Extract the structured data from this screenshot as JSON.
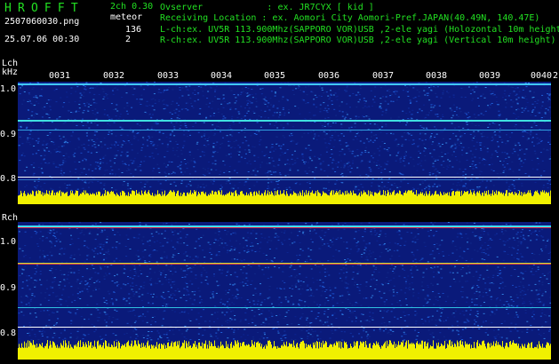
{
  "header": {
    "brand": "HROFFT",
    "filename": "2507060030.png",
    "datetime": "25.07.06 00:30",
    "mode": "2ch 0.30",
    "meteor_label": "meteor",
    "meteor_count": "136",
    "channel_count": "2"
  },
  "info": {
    "observer": "Ovserver            : ex. JR7CYX [ kid ]",
    "location": "Receiving Location : ex. Aomori City Aomori-Pref.JAPAN(40.49N, 140.47E)",
    "lch": "L-ch:ex. UV5R 113.900Mhz(SAPPORO VOR)USB ,2-ele yagi (Holozontal 10m height",
    "rch": "R-ch:ex. UV5R 113.900Mhz(SAPPORO VOR)USB ,2-ele yagi (Vertical 10m height)"
  },
  "lch_panel": {
    "label": "Lch",
    "unit": "kHz",
    "ticks": [
      "1.0",
      "0.9",
      "0.8"
    ]
  },
  "rch_panel": {
    "label": "Rch",
    "ticks": [
      "1.0",
      "0.9",
      "0.8"
    ]
  },
  "time_labels": [
    "0031",
    "0032",
    "0033",
    "0034",
    "0035",
    "0036",
    "0037",
    "0038",
    "0039",
    "0040",
    "2"
  ],
  "colors": {
    "background": "#000000",
    "brand_green": "#22e022",
    "info_green": "#22e022",
    "spectrogram_base": "#0a1a7a",
    "level_yellow": "#f0f000",
    "carrier_cyan": "#40e0ff"
  }
}
